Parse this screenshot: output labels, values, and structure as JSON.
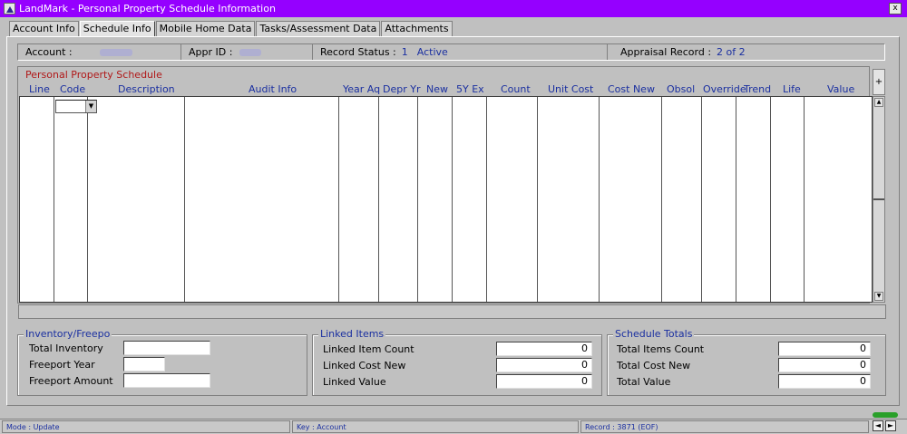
{
  "window": {
    "title": "LandMark - Personal Property Schedule Information",
    "close_glyph": "x"
  },
  "tabs": [
    {
      "label": "Account Info"
    },
    {
      "label": "Schedule Info"
    },
    {
      "label": "Mobile Home Data"
    },
    {
      "label": "Tasks/Assessment Data"
    },
    {
      "label": "Attachments"
    }
  ],
  "active_tab": "Schedule Info",
  "info_bar": {
    "account_label": "Account :",
    "appr_id_label": "Appr ID :",
    "record_status_label": "Record Status :",
    "record_status_code": "1",
    "record_status_text": "Active",
    "appraisal_record_label": "Appraisal Record :",
    "appraisal_record_value": "2 of 2"
  },
  "schedule": {
    "title": "Personal Property Schedule",
    "columns": [
      "Line",
      "Code",
      "Description",
      "Audit Info",
      "Year Aq",
      "Depr Yr",
      "New",
      "5Y Ex",
      "Count",
      "Unit Cost",
      "Cost New",
      "Obsol",
      "Override",
      "Trend",
      "Life",
      "Value"
    ],
    "add_button": "+"
  },
  "inventory": {
    "title": "Inventory/Freepo",
    "total_inventory_label": "Total Inventory",
    "total_inventory_value": "",
    "freeport_year_label": "Freeport Year",
    "freeport_year_value": "",
    "freeport_amount_label": "Freeport Amount",
    "freeport_amount_value": ""
  },
  "linked": {
    "title": "Linked Items",
    "count_label": "Linked Item Count",
    "count_value": "0",
    "cost_label": "Linked Cost New",
    "cost_value": "0",
    "value_label": "Linked Value",
    "value_value": "0"
  },
  "totals": {
    "title": "Schedule Totals",
    "items_label": "Total Items Count",
    "items_value": "0",
    "cost_label": "Total Cost New",
    "cost_value": "0",
    "value_label": "Total Value",
    "value_value": "0"
  },
  "status_bar": {
    "mode": "Mode : Update",
    "key": "Key : Account",
    "record": "Record : 3871 (EOF)"
  },
  "nav": {
    "prev": "◄",
    "next": "►"
  }
}
